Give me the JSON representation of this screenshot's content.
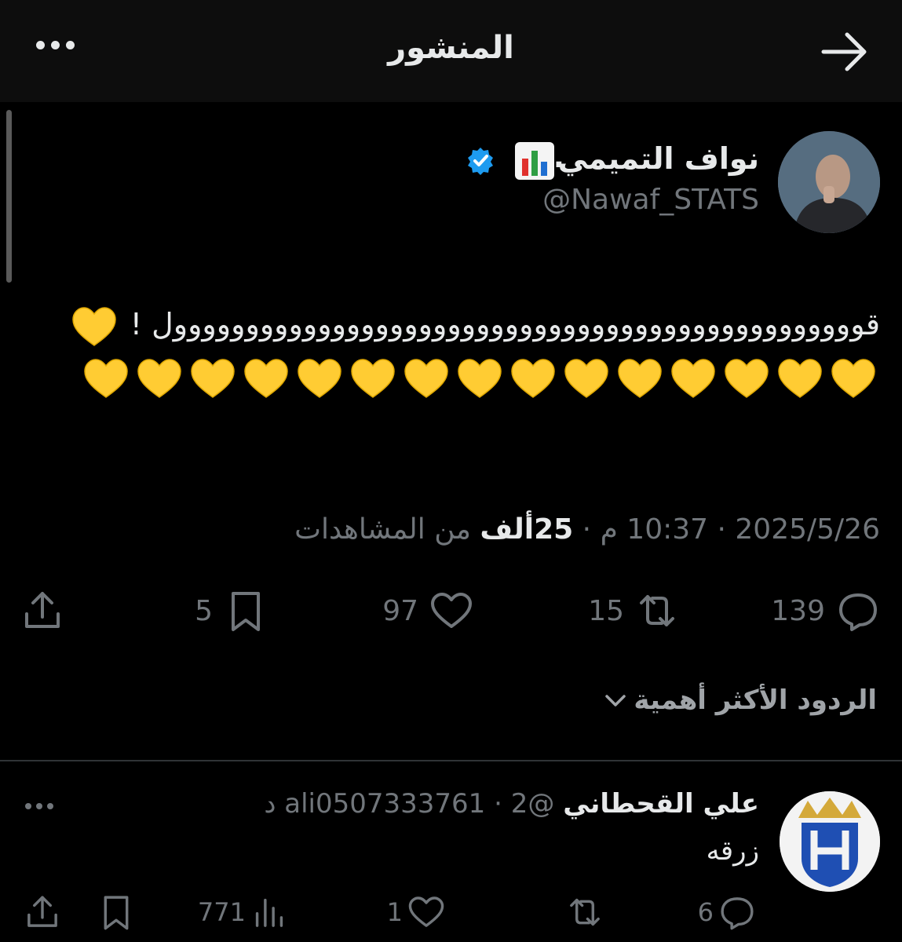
{
  "header": {
    "title": "المنشور"
  },
  "post": {
    "author_name": "نواف التميمي",
    "author_suffix": ".",
    "handle": "@Nawaf_STATS",
    "text_main": "قوووووووووووووووووووووووووووووووووووووووووووووووول !",
    "heart_emoji_count": 16,
    "date": "2025/5/26",
    "time": "10:37 م",
    "views_value": "25ألف",
    "views_label": "من المشاهدات",
    "sep": "·"
  },
  "actions": {
    "replies": "139",
    "reposts": "15",
    "likes": "97",
    "bookmarks": "5"
  },
  "replies_sort": {
    "label": "الردود الأكثر أهمية"
  },
  "reply": {
    "name": "علي القحطاني",
    "handle": "@ali0507333761",
    "time": "2 د",
    "sep": "·",
    "text": "زرقه",
    "replies": "6",
    "reposts": "",
    "likes": "1",
    "views": "771"
  },
  "colors": {
    "background": "#000000",
    "text": "#e7e9ea",
    "muted": "#71767b",
    "verified": "#1d9bf0",
    "heart": "#ffcc33"
  },
  "icons": {
    "back": "arrow-right-icon",
    "more": "more-dots-icon",
    "verified": "verified-badge-icon",
    "reply": "reply-icon",
    "repost": "repost-icon",
    "like": "heart-outline-icon",
    "bookmark": "bookmark-icon",
    "share": "share-icon",
    "views": "views-chart-icon"
  }
}
